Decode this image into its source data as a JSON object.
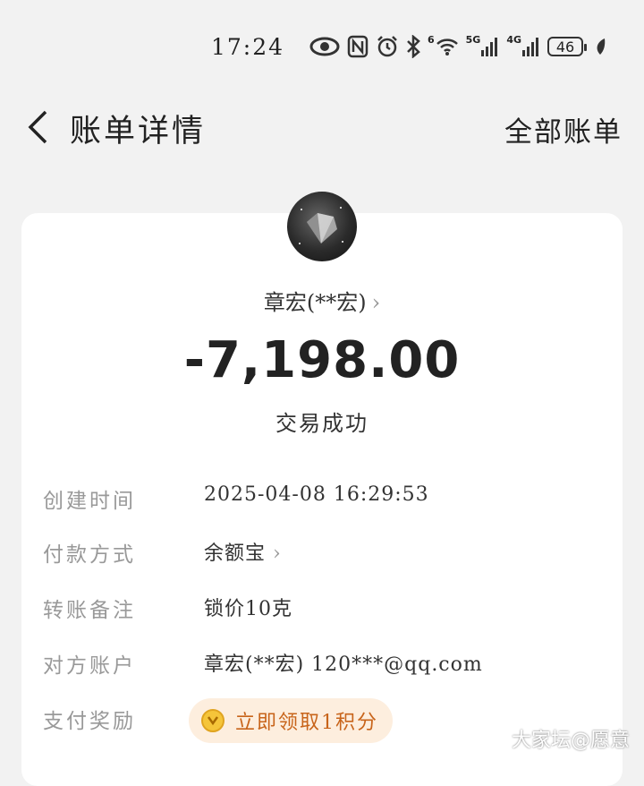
{
  "status_bar": {
    "time": "17:24",
    "network_6": "6",
    "network_5g": "5G",
    "network_4g": "4G",
    "battery": "46"
  },
  "header": {
    "title": "账单详情",
    "all_bills": "全部账单"
  },
  "detail": {
    "payee": "章宏(**宏)",
    "amount": "-7,198.00",
    "status": "交易成功",
    "rows": [
      {
        "label": "创建时间",
        "value": "2025-04-08  16:29:53"
      },
      {
        "label": "付款方式",
        "value": "余额宝"
      },
      {
        "label": "转账备注",
        "value": "锁价10克"
      },
      {
        "label": "对方账户",
        "value": "章宏(**宏) 120***@qq.com"
      },
      {
        "label": "支付奖励",
        "value": "立即领取1积分"
      }
    ]
  },
  "watermark": "大家坛@愿意",
  "colors": {
    "background": "#f2f2f2",
    "card": "#ffffff",
    "reward_bg": "#fdeede",
    "reward_text": "#c8641a",
    "label": "#999999"
  }
}
